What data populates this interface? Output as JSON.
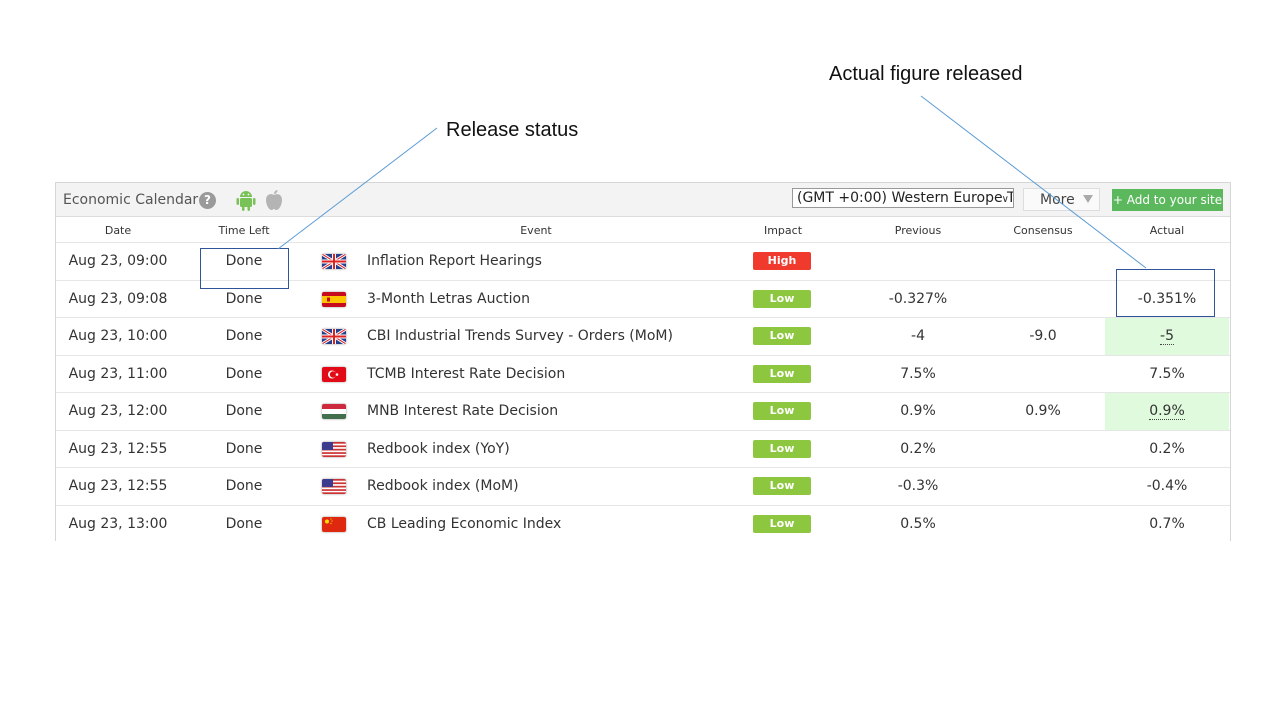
{
  "annotations": {
    "release_status": "Release status",
    "actual_figure": "Actual figure released"
  },
  "widget": {
    "title": "Economic Calendar",
    "help_symbol": "?",
    "timezone": "(GMT +0:00) Western Europe T",
    "more_label": "More",
    "add_label": "+ Add to your site",
    "icons": [
      "android-icon",
      "apple-icon",
      "help-icon",
      "chevron-down-icon"
    ]
  },
  "columns": {
    "date": "Date",
    "time_left": "Time Left",
    "event": "Event",
    "impact": "Impact",
    "previous": "Previous",
    "consensus": "Consensus",
    "actual": "Actual"
  },
  "colors": {
    "high": "#f03a2e",
    "low": "#8dc63f",
    "add_button": "#5cb85c",
    "better_actual": "#dffadc",
    "callout_box": "#2f5597"
  },
  "rows": [
    {
      "date": "Aug 23, 09:00",
      "time_left": "Done",
      "flag": "gb",
      "event": "Inflation Report Hearings",
      "impact": "High",
      "previous": "",
      "consensus": "",
      "actual": "",
      "highlight": false
    },
    {
      "date": "Aug 23, 09:08",
      "time_left": "Done",
      "flag": "es",
      "event": "3-Month Letras Auction",
      "impact": "Low",
      "previous": "-0.327%",
      "consensus": "",
      "actual": "-0.351%",
      "highlight": false
    },
    {
      "date": "Aug 23, 10:00",
      "time_left": "Done",
      "flag": "gb",
      "event": "CBI Industrial Trends Survey - Orders (MoM)",
      "impact": "Low",
      "previous": "-4",
      "consensus": "-9.0",
      "actual": "-5",
      "highlight": true
    },
    {
      "date": "Aug 23, 11:00",
      "time_left": "Done",
      "flag": "tr",
      "event": "TCMB Interest Rate Decision",
      "impact": "Low",
      "previous": "7.5%",
      "consensus": "",
      "actual": "7.5%",
      "highlight": false
    },
    {
      "date": "Aug 23, 12:00",
      "time_left": "Done",
      "flag": "hu",
      "event": "MNB Interest Rate Decision",
      "impact": "Low",
      "previous": "0.9%",
      "consensus": "0.9%",
      "actual": "0.9%",
      "highlight": true
    },
    {
      "date": "Aug 23, 12:55",
      "time_left": "Done",
      "flag": "us",
      "event": "Redbook index (YoY)",
      "impact": "Low",
      "previous": "0.2%",
      "consensus": "",
      "actual": "0.2%",
      "highlight": false
    },
    {
      "date": "Aug 23, 12:55",
      "time_left": "Done",
      "flag": "us",
      "event": "Redbook index (MoM)",
      "impact": "Low",
      "previous": "-0.3%",
      "consensus": "",
      "actual": "-0.4%",
      "highlight": false
    },
    {
      "date": "Aug 23, 13:00",
      "time_left": "Done",
      "flag": "cn",
      "event": "CB Leading Economic Index",
      "impact": "Low",
      "previous": "0.5%",
      "consensus": "",
      "actual": "0.7%",
      "highlight": false
    }
  ]
}
